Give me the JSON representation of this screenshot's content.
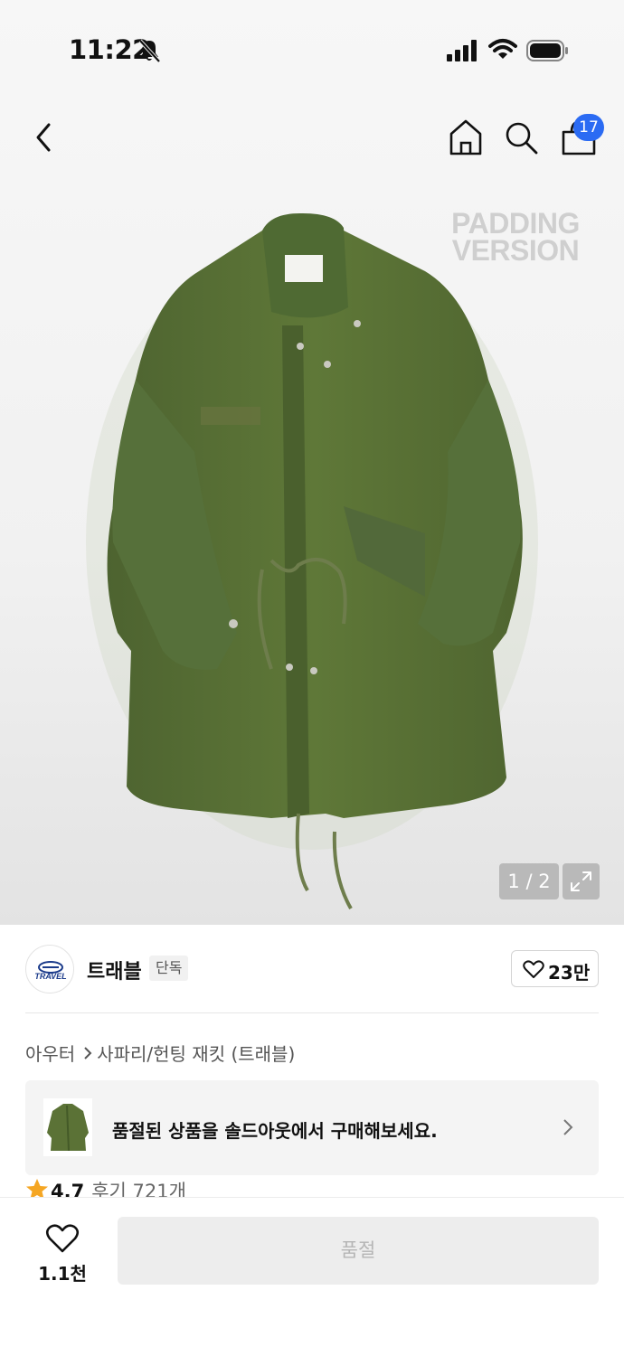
{
  "status_bar": {
    "time": "11:22"
  },
  "header": {
    "cart_badge": "17"
  },
  "hero": {
    "overlay_text_line1": "PADDING",
    "overlay_text_line2": "VERSION",
    "image_counter": "1 / 2",
    "coat_color": "#5b7236"
  },
  "brand": {
    "logo_text": "TRAVEL",
    "name": "트래블",
    "tag": "단독",
    "like_count": "23만"
  },
  "breadcrumb": {
    "category": "아우터",
    "subcategory": "사파리/헌팅 재킷 (트래블)"
  },
  "soldout_banner": {
    "text": "품절된 상품을 솔드아웃에서 구매해보세요."
  },
  "rating": {
    "value": "4.7",
    "reviews": "후기 721개"
  },
  "bottom_bar": {
    "wish_count": "1.1천",
    "buy_label": "품절"
  },
  "colors": {
    "badge_blue": "#2b6bf3",
    "star_orange": "#f5a623",
    "disabled_button": "#ededed"
  }
}
